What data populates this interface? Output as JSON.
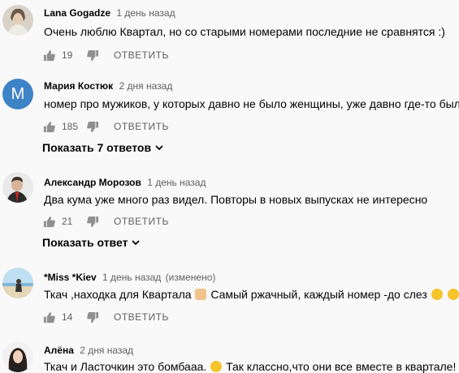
{
  "comments": [
    {
      "author": "Lana Gogadze",
      "time": "1 день назад",
      "text": "Очень люблю Квартал, но со старыми номерами последние не сравнятся :)",
      "likes": "19",
      "reply_label": "ОТВЕТИТЬ"
    },
    {
      "author": "Мария Костюк",
      "avatar_letter": "M",
      "time": "2 дня назад",
      "text": "номер про мужиков, у которых давно не было женщины, уже давно где-то был",
      "likes": "185",
      "reply_label": "ОТВЕТИТЬ",
      "replies_toggle": "Показать 7 ответов"
    },
    {
      "author": "Александр Морозов",
      "time": "1 день назад",
      "text": "Два кума уже много раз видел. Повторы в новых выпусках не интересно",
      "likes": "21",
      "reply_label": "ОТВЕТИТЬ",
      "replies_toggle": "Показать ответ"
    },
    {
      "author": "*Miss *Kiev",
      "time": "1 день назад",
      "edited": "(изменено)",
      "text_part1": "Ткач ,находка для Квартала",
      "text_part2": "Самый ржачный, каждый номер -до слез",
      "likes": "14",
      "reply_label": "ОТВЕТИТЬ"
    },
    {
      "author": "Алёна",
      "time": "2 дня назад",
      "text_part1": "Ткач и Ласточкин это бомбааа.",
      "text_part2": "Так классно,что они все вместе в квартале!"
    }
  ],
  "colors": {
    "avatar_letter_bg": "#3f83c7",
    "meta_text": "#606060",
    "icon": "#909090"
  }
}
